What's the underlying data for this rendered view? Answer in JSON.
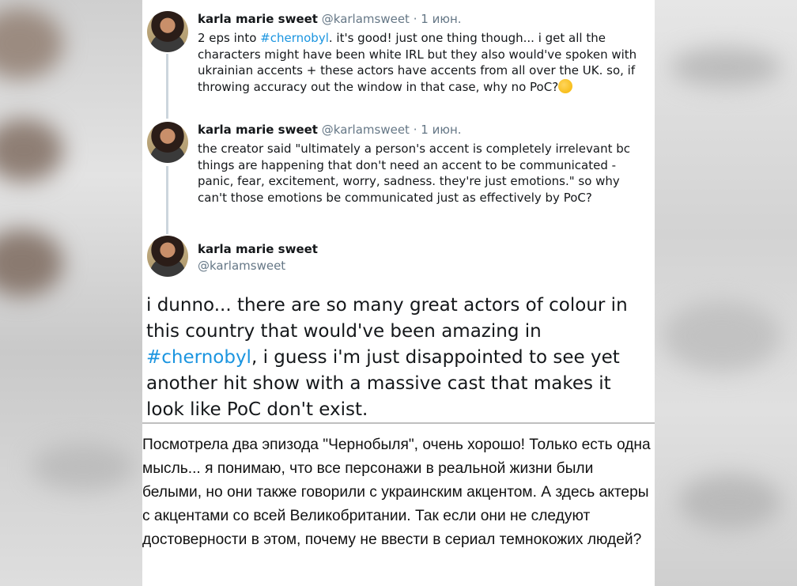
{
  "tweets": [
    {
      "name": "karla marie sweet",
      "handle": "@karlamsweet",
      "separator": "·",
      "date": "1 июн.",
      "text_before": "2 eps into ",
      "hashtag": "#chernobyl",
      "text_after": ". it's good! just one thing though... i get all the characters might have been white IRL but they also would've spoken with ukrainian accents + these actors have accents from all over the UK. so, if throwing accuracy out the window in that case, why no PoC?",
      "emoji_icon": "thinking-face-icon"
    },
    {
      "name": "karla marie sweet",
      "handle": "@karlamsweet",
      "separator": "·",
      "date": "1 июн.",
      "text": "the creator said \"ultimately a person's accent is completely irrelevant bc things are happening that don't need an accent to be communicated - panic, fear, excitement, worry, sadness. they're just emotions.\" so why can't those emotions be communicated just as effectively by PoC?"
    }
  ],
  "main_tweet": {
    "name": "karla marie sweet",
    "handle": "@karlamsweet",
    "text_before": "i dunno... there are so many great actors of colour in this country that would've been amazing in ",
    "hashtag": "#chernobyl",
    "text_after": ", i guess i'm just disappointed to see yet another hit show with a massive cast that makes it look like PoC don't exist."
  },
  "translation": "Посмотрела два эпизода \"Чернобыля\", очень хорошо! Только есть одна мысль... я понимаю, что все персонажи в реальной жизни были белыми, но они также говорили с украинским акцентом. А здесь актеры с акцентами со всей Великобритании. Так если они не следуют достоверности в этом, почему не ввести в сериал темнокожих людей?",
  "colors": {
    "hashtag": "#1b95e0",
    "secondary_text": "#657786",
    "thread_line": "#ccd6dd"
  }
}
